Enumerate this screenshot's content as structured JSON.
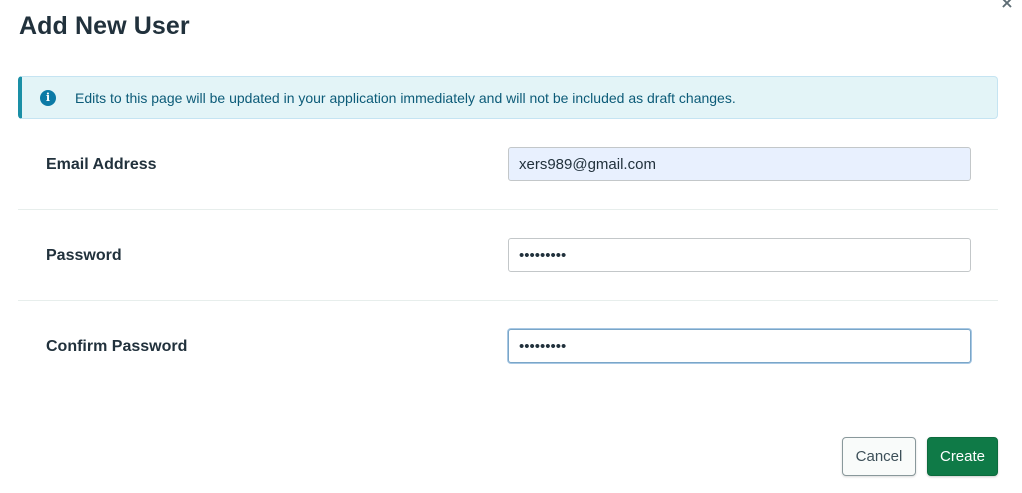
{
  "modal": {
    "title": "Add New User",
    "close_glyph": "×"
  },
  "banner": {
    "icon": "info-icon",
    "icon_glyph": "i",
    "text": "Edits to this page will be updated in your application immediately and will not be included as draft changes."
  },
  "form": {
    "email": {
      "label": "Email Address",
      "value": "xers989@gmail.com"
    },
    "password": {
      "label": "Password",
      "value": "•••••••••"
    },
    "confirm_password": {
      "label": "Confirm Password",
      "value": "•••••••••"
    }
  },
  "footer": {
    "cancel_label": "Cancel",
    "create_label": "Create"
  },
  "colors": {
    "create_button": "#0f7a47",
    "banner_background": "#e3f4f7",
    "banner_accent": "#1a8fa6"
  }
}
